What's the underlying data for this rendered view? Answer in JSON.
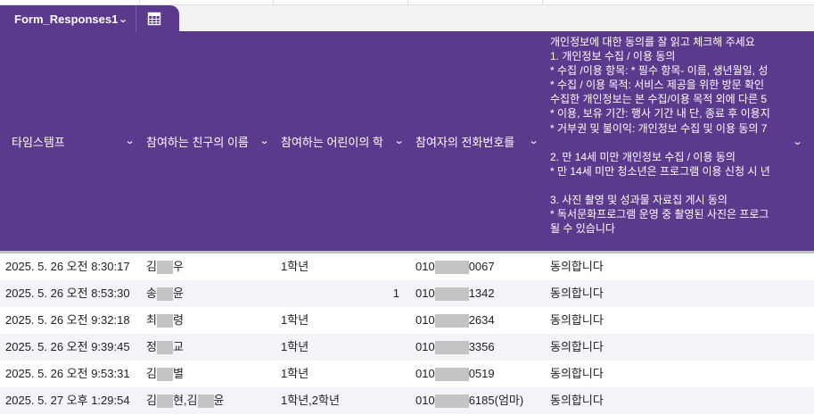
{
  "tab": {
    "name": "Form_Responses1",
    "chevron_icon": "chevron-down-icon",
    "grid_icon": "table-grid-icon"
  },
  "columns": [
    {
      "label": "타임스탬프"
    },
    {
      "label": "참여하는 친구의 이름"
    },
    {
      "label": "참여하는 어린이의 학"
    },
    {
      "label": "참여자의 전화번호를"
    }
  ],
  "consent_header": [
    "개인정보에 대한 동의를 잘 읽고 체크해 주세요",
    "1. 개인정보 수집 / 이용 동의",
    "* 수집 /이용 항목: * 필수 항목- 이름, 생년월일, 성",
    "* 수집 / 이용 목적: 서비스 제공을 위한 방문 확인",
    "수집한 개인정보는 본 수집/이용 목적 외에 다른 5",
    "* 이용, 보유 기간: 행사 기간 내 단, 종료 후 이용지",
    "* 거부권 및 불이익: 개인정보 수집 및 이용 동의 7",
    "",
    "2. 만 14세 미만 개인정보 수집 / 이용 동의",
    "* 만 14세 미만 청소년은 프로그램 이용 신청 시 년",
    "",
    "3. 사진 촬영 및 성과물 자료집 게시 동의",
    "* 독서문화프로그램 운영 중 촬영된 사진은 프로그",
    "될 수 있습니다"
  ],
  "rows": [
    {
      "timestamp": "2025. 5. 26 오전 8:30:17",
      "name_a": "김",
      "name_b": "우",
      "grade": "1학년",
      "grade_num": "",
      "phone_a": "010",
      "phone_b": "0067",
      "consent": "동의합니다"
    },
    {
      "timestamp": "2025. 5. 26 오전 8:53:30",
      "name_a": "송",
      "name_b": "윤",
      "grade": "",
      "grade_num": "1",
      "phone_a": "010",
      "phone_b": "1342",
      "consent": "동의합니다"
    },
    {
      "timestamp": "2025. 5. 26 오전 9:32:18",
      "name_a": "최",
      "name_b": "령",
      "grade": "1학년",
      "grade_num": "",
      "phone_a": "010",
      "phone_b": "2634",
      "consent": "동의합니다"
    },
    {
      "timestamp": "2025. 5. 26 오전 9:39:45",
      "name_a": "정",
      "name_b": "교",
      "grade": "1학년",
      "grade_num": "",
      "phone_a": "010",
      "phone_b": "3356",
      "consent": "동의합니다"
    },
    {
      "timestamp": "2025. 5. 26 오전 9:53:31",
      "name_a": "김",
      "name_b": "별",
      "grade": "1학년",
      "grade_num": "",
      "phone_a": "010",
      "phone_b": "0519",
      "consent": "동의합니다"
    },
    {
      "timestamp": "2025. 5. 27 오후 1:29:54",
      "name_a": "김",
      "name_b": "현,김",
      "name_c": "윤",
      "grade": "1학년,2학년",
      "grade_num": "",
      "phone_a": "010",
      "phone_b": "6185(엄마)",
      "consent": "동의합니다"
    }
  ]
}
